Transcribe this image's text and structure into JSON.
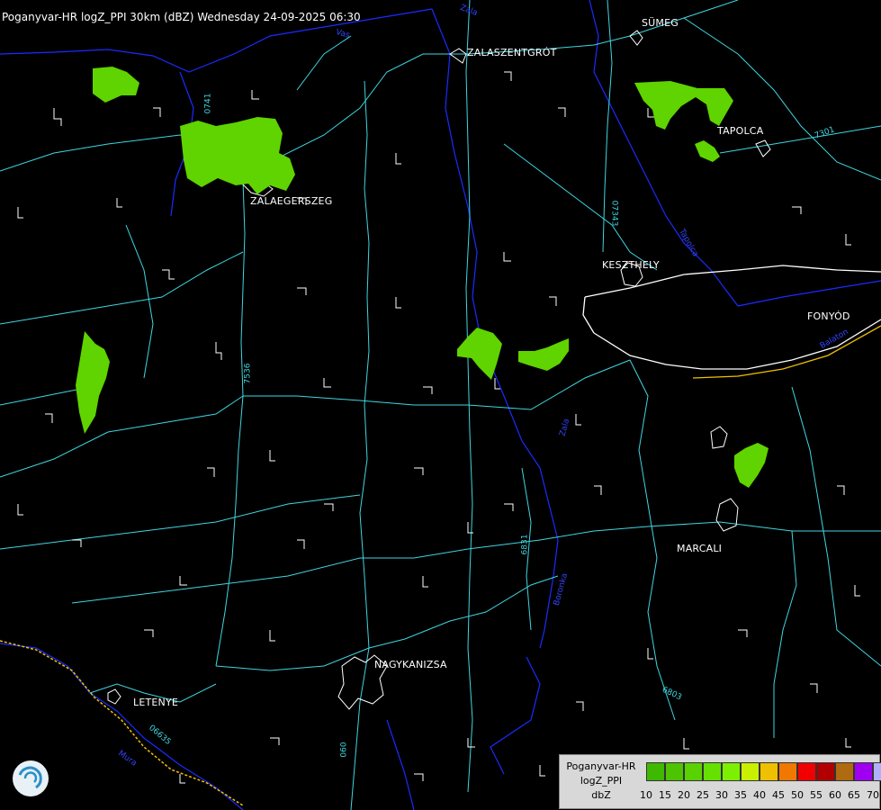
{
  "title": "Poganyvar-HR logZ_PPI 30km (dBZ) Wednesday 24-09-2025 06:30",
  "cities": {
    "sumeg": "SÜMEG",
    "zalaszentgrot": "ZALASZENTGRÓT",
    "tapolca": "TAPOLCA",
    "zalaegerszeg": "ZALAEGERSZEG",
    "keszthely": "KESZTHELY",
    "fonyod": "FONYÓD",
    "marcali": "MARCALI",
    "nagykanizsa": "NAGYKANIZSA",
    "letenye": "LETENYE"
  },
  "road_labels": {
    "r0741": "0741",
    "r7301": "7301",
    "r07343": "07343",
    "r7536": "7536",
    "r6831": "6831",
    "r6803": "6803",
    "r06635": "06635",
    "r060": "060"
  },
  "river_labels": {
    "zala": "Zala",
    "zala_top": "Zala",
    "vas": "Vas",
    "balaton": "Balaton",
    "boronka": "Boronka",
    "tapolca_r": "Tapolca",
    "mura": "Mura"
  },
  "legend": {
    "name_line1": "Poganyvar-HR",
    "name_line2": "logZ_PPI",
    "name_line3": "dbZ",
    "ticks": [
      "10",
      "15",
      "20",
      "25",
      "30",
      "35",
      "40",
      "45",
      "50",
      "55",
      "60",
      "65",
      "70"
    ],
    "colors": [
      "#3fb800",
      "#4ec400",
      "#5ad100",
      "#66e000",
      "#7cf000",
      "#c8f000",
      "#f0c000",
      "#f07800",
      "#f00000",
      "#b00000",
      "#b06a10",
      "#a000f0",
      "#b0b0ff"
    ]
  },
  "colors": {
    "background": "#000000",
    "roads": "#3fd6e0",
    "rivers": "#1a2cff",
    "borders": "#ffffff",
    "echo": "#5fd400"
  },
  "icons": {
    "logo": "radar-swirl-logo-icon"
  }
}
